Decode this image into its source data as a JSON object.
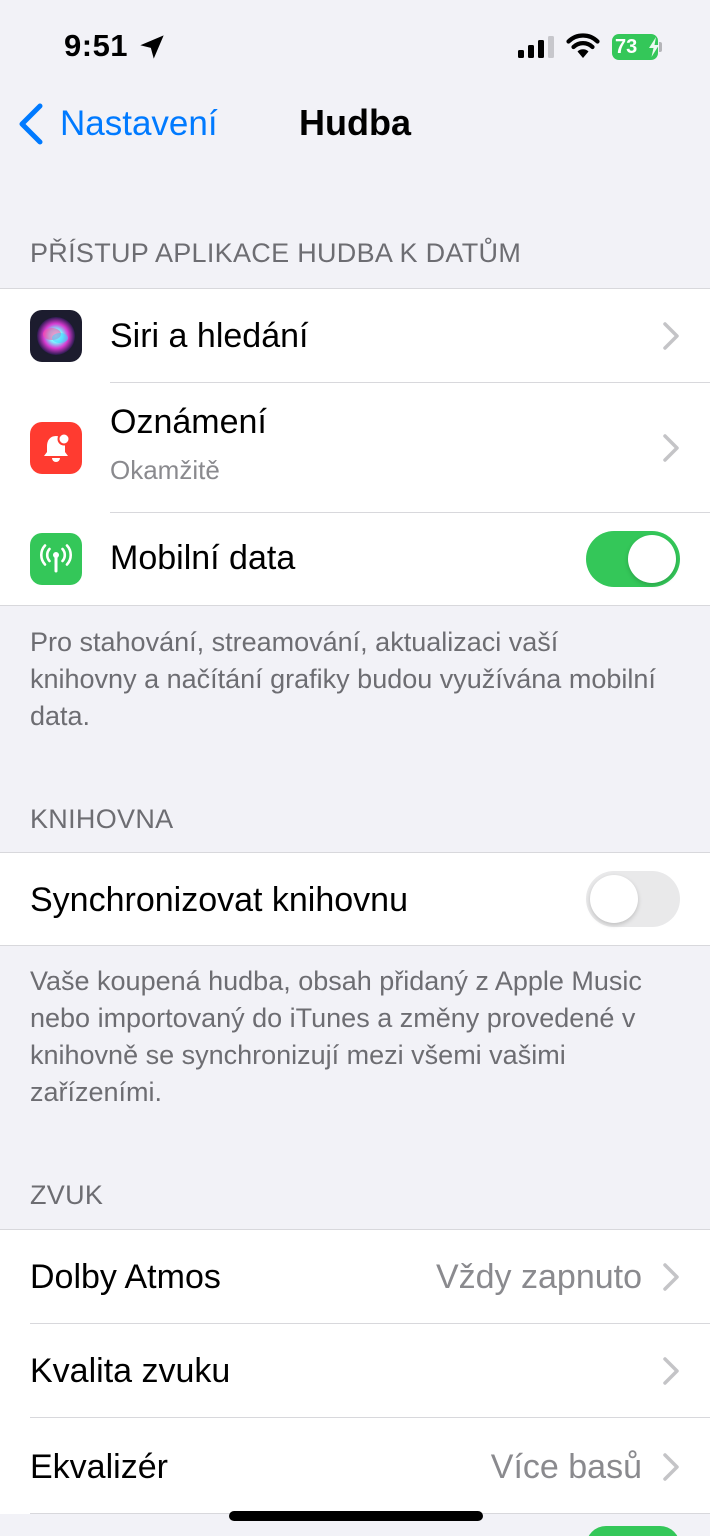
{
  "status_bar": {
    "time": "9:51",
    "battery": "73"
  },
  "nav": {
    "back_label": "Nastavení",
    "title": "Hudba"
  },
  "sections": {
    "access": {
      "header": "PŘÍSTUP APLIKACE HUDBA K DATŮM",
      "rows": {
        "siri": {
          "label": "Siri a hledání"
        },
        "notifications": {
          "label": "Oznámení",
          "sub": "Okamžitě"
        },
        "mobile_data": {
          "label": "Mobilní data",
          "enabled": true
        }
      },
      "footer": "Pro stahování, streamování, aktualizaci vaší knihovny a načítání grafiky budou využívána mobilní data."
    },
    "library": {
      "header": "KNIHOVNA",
      "rows": {
        "sync": {
          "label": "Synchronizovat knihovnu",
          "enabled": false
        }
      },
      "footer": "Vaše koupená hudba, obsah přidaný z Apple Music nebo importovaný do iTunes a změny provedené v knihovně se synchronizují mezi všemi vašimi zařízeními."
    },
    "sound": {
      "header": "ZVUK",
      "rows": {
        "dolby": {
          "label": "Dolby Atmos",
          "value": "Vždy zapnuto"
        },
        "quality": {
          "label": "Kvalita zvuku"
        },
        "eq": {
          "label": "Ekvalizér",
          "value": "Více basů"
        }
      }
    }
  },
  "colors": {
    "accent": "#007aff",
    "toggle_on": "#34c759",
    "background": "#f2f2f7",
    "siri_icon": "#1c1c2e",
    "notifications_icon": "#ff3b30",
    "mobile_data_icon": "#34c759"
  }
}
